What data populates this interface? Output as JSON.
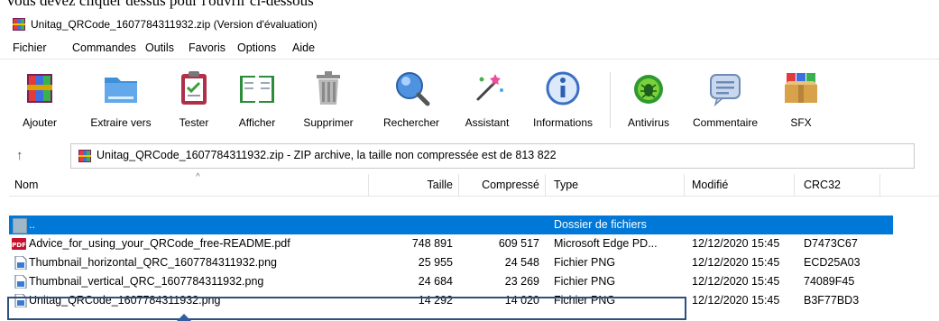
{
  "caption_fragment": "Vous devez cliquer dessus pour l'ouvrir ci-dessous",
  "window": {
    "title": "Unitag_QRCode_1607784311932.zip (Version d'évaluation)"
  },
  "menu": [
    "Fichier",
    "Commandes",
    "Outils",
    "Favoris",
    "Options",
    "Aide"
  ],
  "toolbar": [
    {
      "label": "Ajouter",
      "icon": "add-archive-icon"
    },
    {
      "label": "Extraire vers",
      "icon": "extract-folder-icon"
    },
    {
      "label": "Tester",
      "icon": "test-clipboard-icon"
    },
    {
      "label": "Afficher",
      "icon": "view-book-icon"
    },
    {
      "label": "Supprimer",
      "icon": "trash-icon"
    },
    {
      "label": "Rechercher",
      "icon": "magnifier-icon"
    },
    {
      "label": "Assistant",
      "icon": "wizard-wand-icon"
    },
    {
      "label": "Informations",
      "icon": "info-icon"
    },
    {
      "label": "Antivirus",
      "icon": "antivirus-bug-icon"
    },
    {
      "label": "Commentaire",
      "icon": "comment-icon"
    },
    {
      "label": "SFX",
      "icon": "sfx-box-icon"
    }
  ],
  "address": {
    "text": "Unitag_QRCode_1607784311932.zip - ZIP archive, la taille non compressée est de 813 822"
  },
  "columns": [
    "Nom",
    "Taille",
    "Compressé",
    "Type",
    "Modifié",
    "CRC32"
  ],
  "rows": [
    {
      "name": "..",
      "size": "",
      "packed": "",
      "type": "Dossier de fichiers",
      "modified": "",
      "crc": "",
      "icon": "folder-icon",
      "selected": true
    },
    {
      "name": "Advice_for_using_your_QRCode_free-README.pdf",
      "size": "748 891",
      "packed": "609 517",
      "type": "Microsoft Edge PD...",
      "modified": "12/12/2020 15:45",
      "crc": "D7473C67",
      "icon": "pdf-icon",
      "selected": false
    },
    {
      "name": "Thumbnail_horizontal_QRC_1607784311932.png",
      "size": "25 955",
      "packed": "24 548",
      "type": "Fichier PNG",
      "modified": "12/12/2020 15:45",
      "crc": "ECD25A03",
      "icon": "png-file-icon",
      "selected": false
    },
    {
      "name": "Thumbnail_vertical_QRC_1607784311932.png",
      "size": "24 684",
      "packed": "23 269",
      "type": "Fichier PNG",
      "modified": "12/12/2020 15:45",
      "crc": "74089F45",
      "icon": "png-file-icon",
      "selected": false
    },
    {
      "name": "Unitag_QRCode_1607784311932.png",
      "size": "14 292",
      "packed": "14 020",
      "type": "Fichier PNG",
      "modified": "12/12/2020 15:45",
      "crc": "B3F77BD3",
      "icon": "png-file-icon",
      "selected": false
    }
  ],
  "colors": {
    "selection": "#0078d7",
    "highlight_border": "#2f4f7f",
    "pdf_red": "#c8102e"
  }
}
